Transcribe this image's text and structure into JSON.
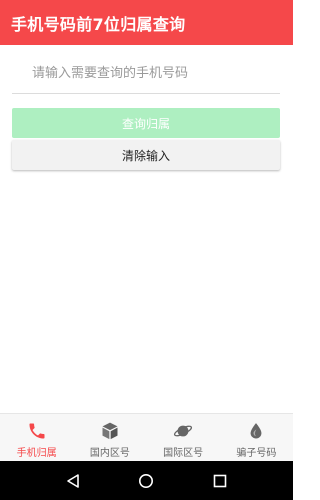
{
  "app_bar": {
    "title": "手机号码前7位归属查询",
    "background_color": "#f5484a"
  },
  "form": {
    "phone_input": {
      "value": "",
      "placeholder": "请输入需要查询的手机号码"
    },
    "query_button_label": "查询归属",
    "clear_button_label": "清除输入"
  },
  "bottom_nav": {
    "active_color": "#f5484a",
    "items": [
      {
        "label": "手机归属",
        "icon": "phone-icon",
        "active": true
      },
      {
        "label": "国内区号",
        "icon": "box-icon",
        "active": false
      },
      {
        "label": "国际区号",
        "icon": "planet-icon",
        "active": false
      },
      {
        "label": "骗子号码",
        "icon": "drop-icon",
        "active": false
      }
    ]
  },
  "system_nav": {
    "buttons": [
      "back-icon",
      "home-icon",
      "recents-icon"
    ]
  }
}
